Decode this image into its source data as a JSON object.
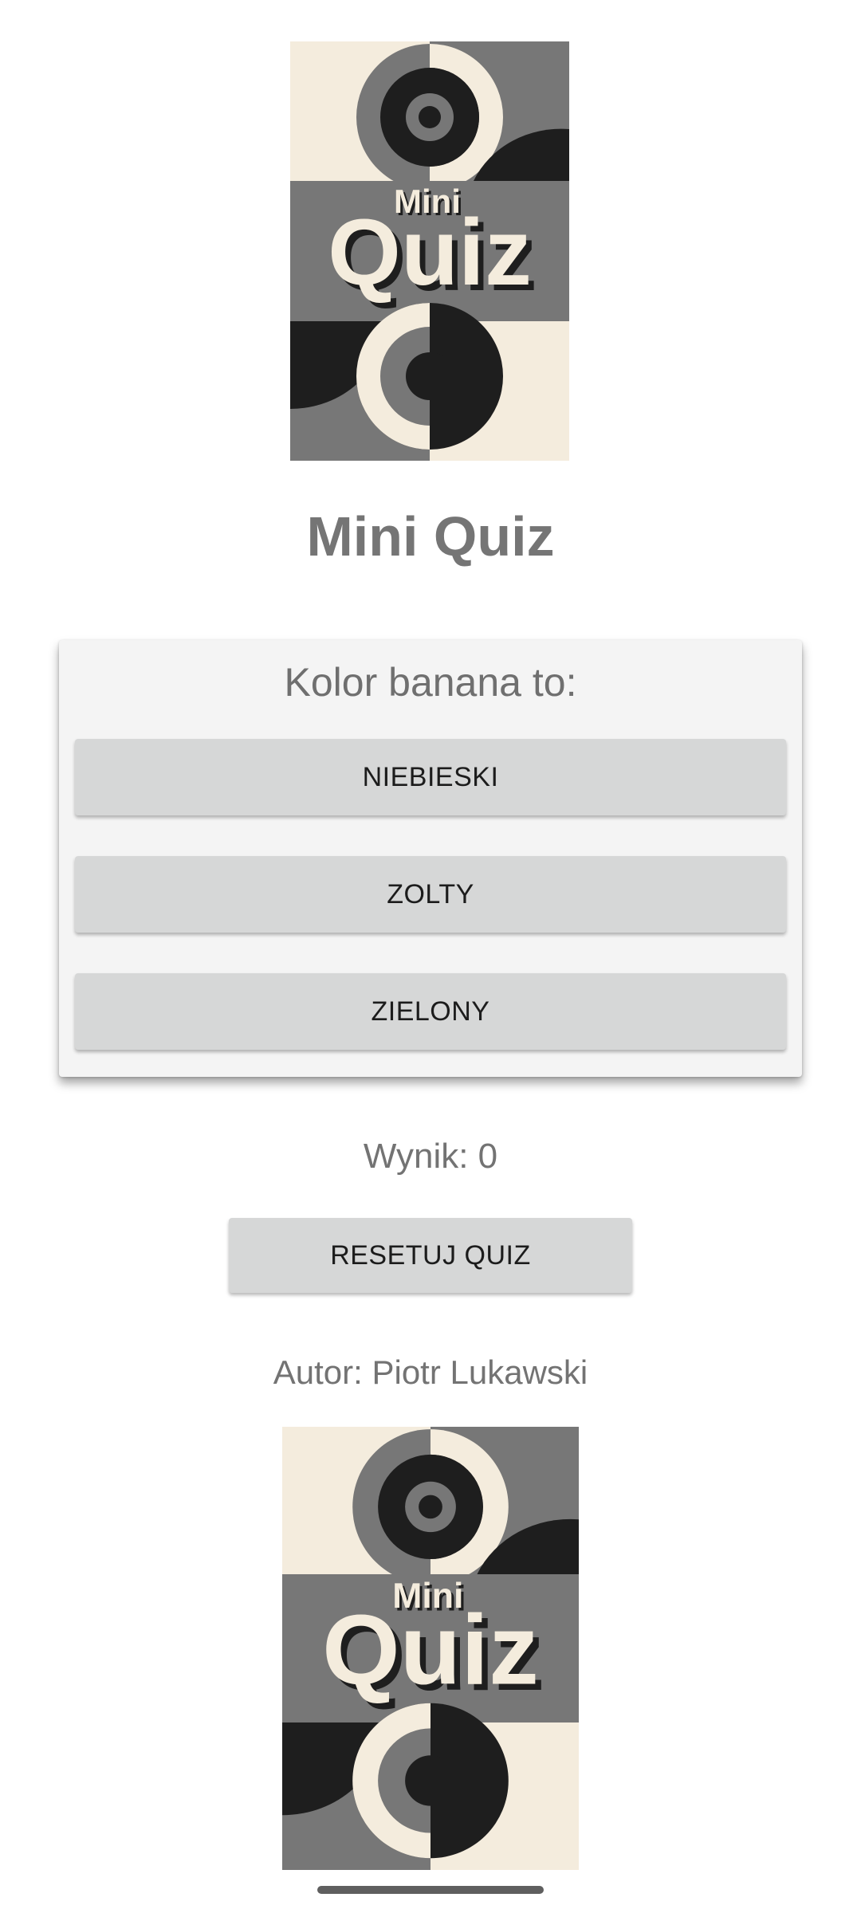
{
  "app": {
    "title": "Mini Quiz"
  },
  "logo": {
    "small_word": "Mini",
    "big_word": "Quiz",
    "colors": {
      "cream": "#f4ecdd",
      "mid_gray": "#777777",
      "dark": "#1e1e1e"
    }
  },
  "question": {
    "text": "Kolor banana to:",
    "answers": [
      {
        "label": "NIEBIESKI"
      },
      {
        "label": "ZOLTY"
      },
      {
        "label": "ZIELONY"
      }
    ]
  },
  "score": {
    "text": "Wynik: 0"
  },
  "reset": {
    "label": "RESETUJ QUIZ"
  },
  "author": {
    "text": "Autor: Piotr Lukawski"
  },
  "theme": {
    "button_bg": "#d6d7d7",
    "card_bg": "#f4f4f4",
    "text_gray": "#757575"
  }
}
